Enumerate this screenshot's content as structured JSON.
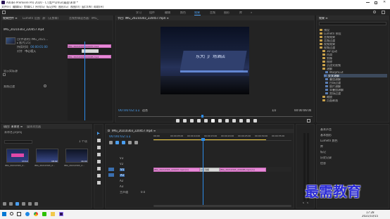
{
  "titlebar": {
    "title": "Adobe Premiere Pro 2020 - C:\\用户\\Ulrus\\桌面\\未命 *"
  },
  "menu": [
    "文件(F)",
    "编辑(E)",
    "剪辑(C)",
    "序列(S)",
    "标记(M)",
    "图形(G)",
    "视图(V)",
    "窗口(W)",
    "帮助(H)"
  ],
  "workspaces": [
    "学习",
    "组件",
    "编辑",
    "颜色",
    "效果",
    "音频",
    "图形",
    "库",
    "»"
  ],
  "active_workspace": "效果",
  "source_panel": {
    "tabs": [
      "效果控件 ≡",
      "Lumetri 范围",
      "源：(无剪辑)",
      "音频剪辑混合器：IMG_"
    ],
    "clip_name": "IMG_20210303_220457.mp4",
    "info_line1": "[文件说明] IMG_2021...",
    "info_line2": "▸ 影片[25]",
    "info_line3": "00:00:13:12",
    "transition_label": "VR 滤镜",
    "show_actual_sources": "显示实际源",
    "duration_label": "持续时间",
    "duration_value": "00:00:01:00",
    "alignment_label": "对齐",
    "alignment_value": "中心切入",
    "effect_name": "渐隐过渡",
    "clips": [
      "IMG_20210303_220457.mp4",
      "IMG_20210303_220485.mp4"
    ]
  },
  "program_panel": {
    "title": "节目: IMG_20210303_220457.mp4 ≡",
    "timecode": "00:00:02:11",
    "fit": "适合",
    "quality": "1/2",
    "duration": "00:00:06:00",
    "video_sign_text": "东大门广场酒店"
  },
  "effects_panel": {
    "title": "效果 ≡",
    "tree": [
      "预设",
      "Lumetri 预设",
      "音频效果",
      "音频过渡",
      "视频效果",
      "视频过渡",
      "3D 运动",
      "内滑",
      "划像",
      "擦除",
      "沉浸式视频",
      "溶解",
      "MorphCut",
      "交叉溶解",
      "叠加溶解",
      "白场过渡",
      "胶片溶解",
      "非叠加溶解",
      "黑场过渡",
      "缩放",
      "页面剥落"
    ],
    "selected_item": "交叉溶解",
    "extra_panels": [
      "基本声音",
      "基本图形",
      "Lumetri 颜色",
      "库",
      "标记",
      "历史记录",
      "信息"
    ]
  },
  "project_panel": {
    "tabs": [
      "项目: 未命名 ≡",
      "媒体浏览器"
    ],
    "project_file": "未命名.prproj",
    "item_count": "1 个项",
    "thumbs": [
      {
        "name": "IMG_20210303_2...",
        "dur": "13:12"
      },
      {
        "name": "IMG_20210303_2...",
        "dur": "18:02"
      },
      {
        "name": "IMG_20210303_2...",
        "dur": "16:00"
      }
    ]
  },
  "timeline": {
    "title": "IMG_20210303_220457.mp4 ≡",
    "timecode": "00:00:02:11",
    "ruler": [
      "00:00",
      "00:00:05:00",
      "00:00:10:00",
      "00:00:15:00",
      "00:00:20:00",
      "00:00:25:00",
      "00:00:30:00",
      "00:00:35:00"
    ],
    "tracks": [
      "V3",
      "V2",
      "V1",
      "A1",
      "A2",
      "A3",
      "主声道"
    ],
    "master_value": "0.0",
    "clip1": "IMG_20210303_220457.mp4 [V]",
    "transition": "交叉溶解",
    "clip2": "IMG_20210303_220485.mp4 [V]"
  },
  "taskbar": {
    "time": "17:28",
    "date": "2021/10/15",
    "watermark": "最需教育"
  },
  "colors": {
    "accent_blue": "#2d8ceb",
    "clip_pink": "#e889d8",
    "playhead": "#2d8ceb",
    "watermark": "#2b2bd6"
  }
}
